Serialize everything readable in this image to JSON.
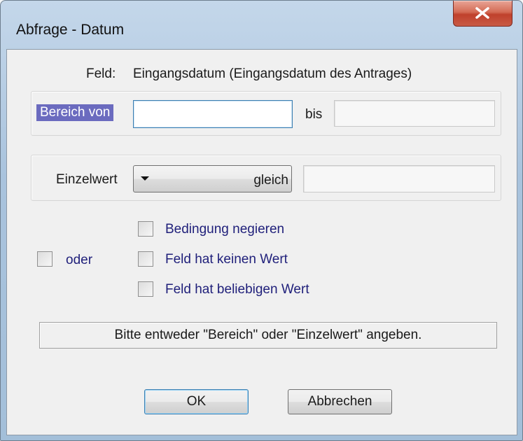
{
  "window": {
    "title": "Abfrage - Datum"
  },
  "field_line": {
    "label": "Feld:",
    "value": "Eingangsdatum (Eingangsdatum des Antrages)"
  },
  "range": {
    "from_label": "Bereich von",
    "from_value": "",
    "to_label": "bis",
    "to_value": ""
  },
  "single": {
    "label": "Einzelwert",
    "operator": "gleich",
    "value": ""
  },
  "options": {
    "or_label": "oder",
    "or_checked": false,
    "checkboxes": [
      {
        "label": "Bedingung negieren",
        "checked": false
      },
      {
        "label": "Feld hat keinen Wert",
        "checked": false
      },
      {
        "label": "Feld hat beliebigen Wert",
        "checked": false
      }
    ]
  },
  "status": {
    "message": "Bitte entweder \"Bereich\" oder \"Einzelwert\" angeben."
  },
  "buttons": {
    "ok": "OK",
    "cancel": "Abbrechen"
  },
  "icons": {
    "close": "close-icon",
    "dropdown": "chevron-down-icon"
  }
}
